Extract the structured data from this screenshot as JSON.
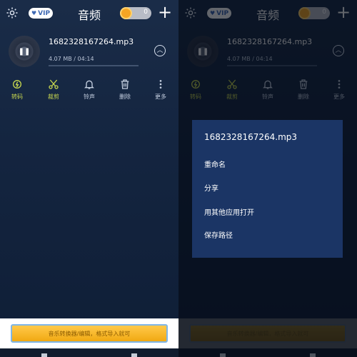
{
  "header": {
    "title": "音频",
    "vip_label": "VIP",
    "toggle_value": "0"
  },
  "file": {
    "name": "1682328167264.mp3",
    "meta": "4.07 MB / 04:14",
    "progress": 0
  },
  "toolbar": {
    "items": [
      {
        "label": "转码",
        "icon": "transcode-icon"
      },
      {
        "label": "裁剪",
        "icon": "scissors-icon"
      },
      {
        "label": "铃声",
        "icon": "bell-icon"
      },
      {
        "label": "删除",
        "icon": "trash-icon"
      },
      {
        "label": "更多",
        "icon": "more-vertical-icon"
      }
    ]
  },
  "banner": {
    "text": "音乐转换器/编辑，格式导入就可"
  },
  "menu": {
    "title": "1682328167264.mp3",
    "items": [
      "重命名",
      "分享",
      "用其他应用打开",
      "保存路径"
    ]
  },
  "colors": {
    "accent": "#c6d64f",
    "background": "#142540",
    "menu_bg": "#1b3565",
    "banner": "#f1a912"
  }
}
